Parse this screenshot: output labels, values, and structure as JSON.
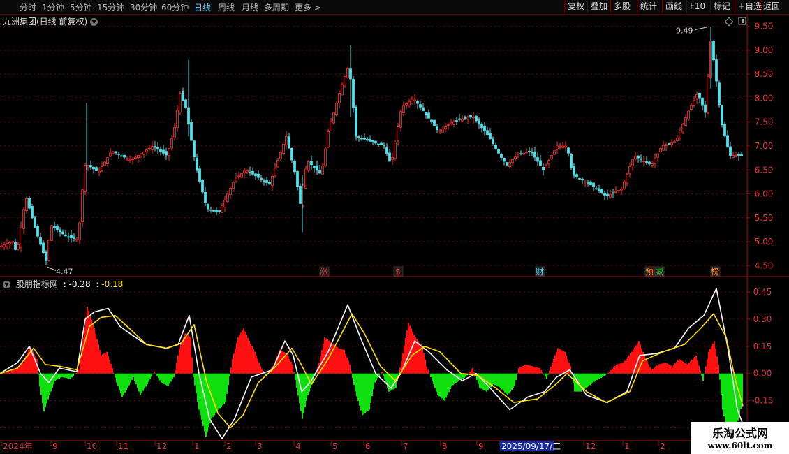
{
  "toolbar": {
    "tabs": [
      "分时",
      "1分钟",
      "5分钟",
      "15分钟",
      "30分钟",
      "60分钟",
      "日线",
      "周线",
      "月线",
      "多周期",
      "更多"
    ],
    "active": "日线",
    "more_arrow": ">",
    "right_buttons": [
      "复权",
      "叠加",
      "多股",
      "统计",
      "画线",
      "F10",
      "标记",
      "+自选",
      "返回"
    ]
  },
  "main": {
    "title": "九洲集团(日线 前复权)",
    "high_label": "9.49",
    "low_label": "4.47",
    "events": [
      {
        "label": "涨",
        "color": "#ff3030"
      },
      {
        "label": "$",
        "color": "#ff3030"
      },
      {
        "label": "财",
        "color": "#5bd0ff"
      },
      {
        "label": "预",
        "color": "#ff9030"
      },
      {
        "label": "减",
        "color": "#30d030"
      },
      {
        "label": "榜",
        "color": "#ff9030"
      }
    ]
  },
  "indicator": {
    "name": "股朋指标网",
    "value1": ": -0.28",
    "value2": ": -0.18"
  },
  "watermark": {
    "line1": "乐淘公式网",
    "line2": "www.60lt.com"
  },
  "chart_data": [
    {
      "type": "candlestick",
      "title": "九洲集团(日线 前复权)",
      "y_axis_ticks": [
        4.5,
        5.0,
        5.5,
        6.0,
        6.5,
        7.0,
        7.5,
        8.0,
        8.5,
        9.0,
        9.5
      ],
      "ylim": [
        4.3,
        9.7
      ],
      "x_axis_labels": [
        "2024年",
        "9",
        "10",
        "11",
        "12",
        "1",
        "2",
        "3",
        "4",
        "5",
        "6",
        "7",
        "8",
        "9",
        "2025/09/17/三",
        "12",
        "1",
        "2"
      ],
      "grid": true,
      "annotations": {
        "high": 9.49,
        "low": 4.47
      },
      "price_path": [
        [
          0,
          4.9
        ],
        [
          18,
          5.0
        ],
        [
          24,
          4.75
        ],
        [
          37,
          5.95
        ],
        [
          52,
          5.2
        ],
        [
          66,
          4.6
        ],
        [
          73,
          5.35
        ],
        [
          96,
          5.1
        ],
        [
          112,
          5.05
        ],
        [
          121,
          6.6
        ],
        [
          126,
          6.6
        ],
        [
          141,
          6.45
        ],
        [
          160,
          6.9
        ],
        [
          187,
          6.7
        ],
        [
          219,
          7.0
        ],
        [
          239,
          6.8
        ],
        [
          249,
          7.3
        ],
        [
          258,
          8.1
        ],
        [
          266,
          7.8
        ],
        [
          280,
          6.6
        ],
        [
          296,
          5.7
        ],
        [
          313,
          5.6
        ],
        [
          336,
          6.3
        ],
        [
          352,
          6.5
        ],
        [
          386,
          6.2
        ],
        [
          410,
          7.2
        ],
        [
          423,
          6.4
        ],
        [
          430,
          5.8
        ],
        [
          440,
          6.7
        ],
        [
          460,
          6.4
        ],
        [
          470,
          7.3
        ],
        [
          488,
          8.2
        ],
        [
          500,
          8.7
        ],
        [
          510,
          7.2
        ],
        [
          530,
          7.1
        ],
        [
          550,
          7.0
        ],
        [
          560,
          6.6
        ],
        [
          575,
          7.8
        ],
        [
          592,
          8.0
        ],
        [
          608,
          7.7
        ],
        [
          628,
          7.3
        ],
        [
          648,
          7.5
        ],
        [
          668,
          7.6
        ],
        [
          678,
          7.6
        ],
        [
          700,
          7.2
        ],
        [
          716,
          6.8
        ],
        [
          726,
          6.6
        ],
        [
          740,
          6.8
        ],
        [
          760,
          6.9
        ],
        [
          778,
          6.5
        ],
        [
          798,
          7.0
        ],
        [
          812,
          7.0
        ],
        [
          820,
          6.4
        ],
        [
          845,
          6.2
        ],
        [
          868,
          5.95
        ],
        [
          890,
          6.1
        ],
        [
          908,
          6.8
        ],
        [
          933,
          6.6
        ],
        [
          948,
          7.0
        ],
        [
          968,
          7.1
        ],
        [
          985,
          7.7
        ],
        [
          999,
          8.1
        ],
        [
          1010,
          7.7
        ],
        [
          1018,
          9.2
        ],
        [
          1024,
          8.6
        ],
        [
          1033,
          7.5
        ],
        [
          1045,
          6.8
        ],
        [
          1062,
          6.8
        ]
      ]
    },
    {
      "type": "area",
      "title": "股朋指标网",
      "y_axis_ticks": [
        -0.3,
        -0.15,
        0.0,
        0.15,
        0.3,
        0.45
      ],
      "ylim": [
        -0.36,
        0.52
      ],
      "series": [
        {
          "color": "#ffffff",
          "points": [
            [
              0,
              0
            ],
            [
              25,
              0.06
            ],
            [
              42,
              0.15
            ],
            [
              58,
              0.0
            ],
            [
              70,
              -0.05
            ],
            [
              85,
              0.03
            ],
            [
              110,
              0.01
            ],
            [
              122,
              0.3
            ],
            [
              135,
              0.34
            ],
            [
              155,
              0.36
            ],
            [
              172,
              0.26
            ],
            [
              190,
              0.21
            ],
            [
              210,
              0.16
            ],
            [
              238,
              0.14
            ],
            [
              255,
              0.16
            ],
            [
              271,
              0.32
            ],
            [
              285,
              0.0
            ],
            [
              300,
              -0.25
            ],
            [
              318,
              -0.36
            ],
            [
              336,
              -0.25
            ],
            [
              360,
              -0.02
            ],
            [
              390,
              0.02
            ],
            [
              408,
              0.18
            ],
            [
              420,
              0.1
            ],
            [
              432,
              -0.1
            ],
            [
              444,
              -0.05
            ],
            [
              470,
              0.12
            ],
            [
              498,
              0.38
            ],
            [
              516,
              0.2
            ],
            [
              538,
              0.0
            ],
            [
              560,
              -0.08
            ],
            [
              574,
              0.0
            ],
            [
              594,
              0.18
            ],
            [
              614,
              0.12
            ],
            [
              640,
              0.02
            ],
            [
              662,
              -0.04
            ],
            [
              682,
              0.0
            ],
            [
              702,
              -0.08
            ],
            [
              730,
              -0.2
            ],
            [
              756,
              -0.13
            ],
            [
              780,
              -0.1
            ],
            [
              797,
              -0.02
            ],
            [
              816,
              0.02
            ],
            [
              840,
              -0.12
            ],
            [
              870,
              -0.16
            ],
            [
              898,
              -0.1
            ],
            [
              916,
              0.1
            ],
            [
              940,
              0.11
            ],
            [
              966,
              0.14
            ],
            [
              986,
              0.25
            ],
            [
              1008,
              0.32
            ],
            [
              1026,
              0.47
            ],
            [
              1042,
              0.15
            ],
            [
              1056,
              -0.2
            ],
            [
              1064,
              -0.28
            ]
          ]
        },
        {
          "color": "#ffe000",
          "points": [
            [
              0,
              0
            ],
            [
              25,
              0.03
            ],
            [
              48,
              0.14
            ],
            [
              65,
              0.05
            ],
            [
              85,
              0.04
            ],
            [
              110,
              0.02
            ],
            [
              128,
              0.26
            ],
            [
              145,
              0.31
            ],
            [
              165,
              0.32
            ],
            [
              185,
              0.25
            ],
            [
              210,
              0.16
            ],
            [
              240,
              0.14
            ],
            [
              260,
              0.17
            ],
            [
              278,
              0.27
            ],
            [
              296,
              -0.05
            ],
            [
              312,
              -0.22
            ],
            [
              330,
              -0.3
            ],
            [
              348,
              -0.23
            ],
            [
              370,
              -0.05
            ],
            [
              395,
              0.04
            ],
            [
              418,
              0.14
            ],
            [
              430,
              0.06
            ],
            [
              446,
              -0.06
            ],
            [
              470,
              0.08
            ],
            [
              504,
              0.33
            ],
            [
              522,
              0.22
            ],
            [
              545,
              0.04
            ],
            [
              566,
              -0.04
            ],
            [
              590,
              0.1
            ],
            [
              608,
              0.15
            ],
            [
              630,
              0.12
            ],
            [
              660,
              0.0
            ],
            [
              684,
              -0.01
            ],
            [
              710,
              -0.08
            ],
            [
              736,
              -0.16
            ],
            [
              770,
              -0.14
            ],
            [
              796,
              -0.06
            ],
            [
              812,
              0.0
            ],
            [
              840,
              -0.1
            ],
            [
              868,
              -0.16
            ],
            [
              902,
              -0.1
            ],
            [
              920,
              0.07
            ],
            [
              950,
              0.12
            ],
            [
              980,
              0.16
            ],
            [
              1006,
              0.26
            ],
            [
              1022,
              0.33
            ],
            [
              1040,
              0.2
            ],
            [
              1054,
              -0.05
            ],
            [
              1064,
              -0.18
            ]
          ]
        }
      ],
      "bars": [
        [
          0,
          0.0
        ],
        [
          12,
          0.01
        ],
        [
          22,
          0.03
        ],
        [
          32,
          0.06
        ],
        [
          42,
          0.15
        ],
        [
          52,
          0.08
        ],
        [
          55,
          -0.05
        ],
        [
          62,
          -0.21
        ],
        [
          70,
          -0.12
        ],
        [
          78,
          -0.04
        ],
        [
          88,
          -0.02
        ],
        [
          100,
          -0.03
        ],
        [
          112,
          0.02
        ],
        [
          118,
          0.2
        ],
        [
          124,
          0.37
        ],
        [
          134,
          0.25
        ],
        [
          144,
          0.1
        ],
        [
          152,
          0.12
        ],
        [
          160,
          0.03
        ],
        [
          166,
          -0.05
        ],
        [
          174,
          -0.13
        ],
        [
          182,
          -0.08
        ],
        [
          190,
          -0.02
        ],
        [
          200,
          -0.12
        ],
        [
          210,
          -0.06
        ],
        [
          220,
          0.01
        ],
        [
          230,
          -0.05
        ],
        [
          240,
          -0.07
        ],
        [
          248,
          -0.02
        ],
        [
          256,
          0.14
        ],
        [
          264,
          0.22
        ],
        [
          272,
          0.2
        ],
        [
          276,
          -0.02
        ],
        [
          284,
          -0.2
        ],
        [
          294,
          -0.35
        ],
        [
          302,
          -0.25
        ],
        [
          312,
          -0.2
        ],
        [
          322,
          -0.16
        ],
        [
          332,
          0.08
        ],
        [
          340,
          0.2
        ],
        [
          348,
          0.25
        ],
        [
          356,
          0.18
        ],
        [
          364,
          0.12
        ],
        [
          372,
          0.04
        ],
        [
          380,
          -0.01
        ],
        [
          390,
          0.04
        ],
        [
          400,
          0.13
        ],
        [
          410,
          0.11
        ],
        [
          418,
          0.05
        ],
        [
          424,
          -0.08
        ],
        [
          432,
          -0.25
        ],
        [
          440,
          -0.12
        ],
        [
          448,
          -0.04
        ],
        [
          456,
          0.06
        ],
        [
          464,
          0.2
        ],
        [
          474,
          0.17
        ],
        [
          484,
          0.14
        ],
        [
          492,
          0.13
        ],
        [
          500,
          0.05
        ],
        [
          508,
          -0.1
        ],
        [
          518,
          -0.23
        ],
        [
          528,
          -0.2
        ],
        [
          536,
          -0.05
        ],
        [
          546,
          0.01
        ],
        [
          556,
          -0.1
        ],
        [
          566,
          -0.08
        ],
        [
          574,
          0.07
        ],
        [
          584,
          0.28
        ],
        [
          594,
          0.2
        ],
        [
          604,
          0.15
        ],
        [
          610,
          0.04
        ],
        [
          616,
          -0.02
        ],
        [
          626,
          -0.12
        ],
        [
          636,
          -0.15
        ],
        [
          646,
          -0.07
        ],
        [
          656,
          -0.04
        ],
        [
          666,
          -0.02
        ],
        [
          676,
          0.03
        ],
        [
          686,
          -0.08
        ],
        [
          696,
          -0.1
        ],
        [
          706,
          -0.06
        ],
        [
          716,
          -0.08
        ],
        [
          726,
          -0.12
        ],
        [
          736,
          -0.07
        ],
        [
          742,
          0.03
        ],
        [
          752,
          0.05
        ],
        [
          762,
          0.04
        ],
        [
          772,
          0.03
        ],
        [
          782,
          -0.03
        ],
        [
          790,
          0.06
        ],
        [
          798,
          0.14
        ],
        [
          808,
          0.12
        ],
        [
          816,
          0.04
        ],
        [
          822,
          -0.1
        ],
        [
          832,
          -0.1
        ],
        [
          842,
          -0.07
        ],
        [
          852,
          -0.04
        ],
        [
          862,
          -0.02
        ],
        [
          872,
          0.01
        ],
        [
          882,
          0.05
        ],
        [
          892,
          0.06
        ],
        [
          904,
          0.12
        ],
        [
          914,
          0.18
        ],
        [
          922,
          0.1
        ],
        [
          932,
          0.02
        ],
        [
          942,
          0.05
        ],
        [
          952,
          0.06
        ],
        [
          962,
          0.04
        ],
        [
          972,
          0.08
        ],
        [
          984,
          0.05
        ],
        [
          996,
          0.1
        ],
        [
          1006,
          -0.04
        ],
        [
          1014,
          0.12
        ],
        [
          1022,
          0.18
        ],
        [
          1028,
          0.05
        ],
        [
          1034,
          -0.2
        ],
        [
          1042,
          -0.35
        ],
        [
          1052,
          -0.33
        ],
        [
          1062,
          -0.16
        ]
      ]
    }
  ]
}
